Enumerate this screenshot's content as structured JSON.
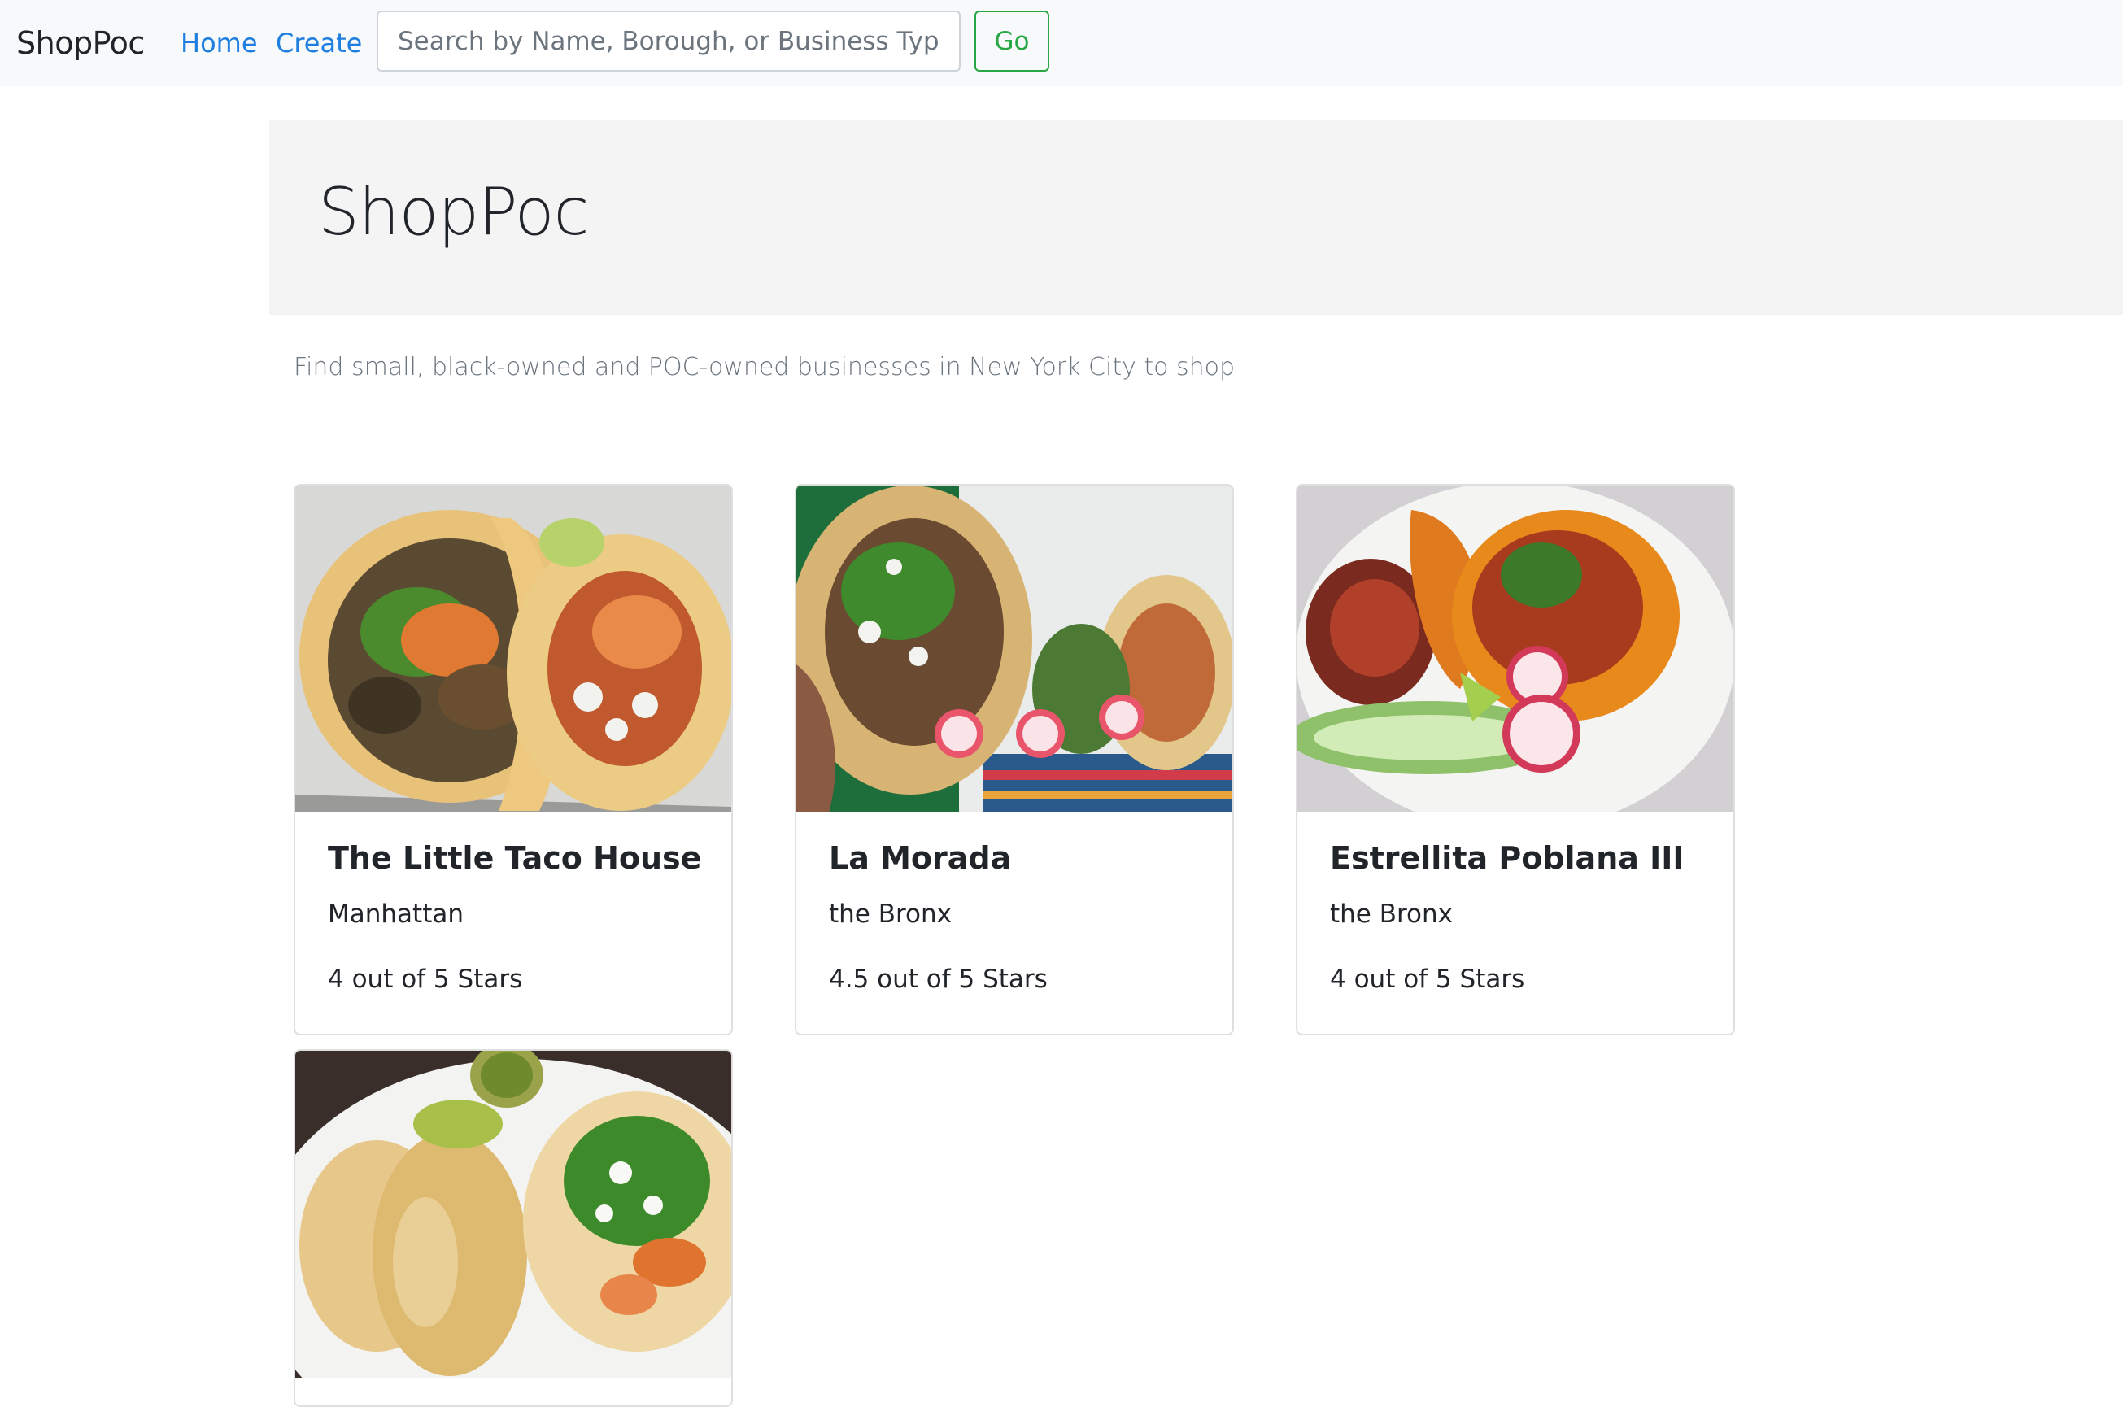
{
  "navbar": {
    "brand": "ShopPoc",
    "links": [
      "Home",
      "Create"
    ],
    "search_placeholder": "Search by Name, Borough, or Business Type",
    "go_label": "Go"
  },
  "jumbotron": {
    "title": "ShopPoc"
  },
  "lead": "Find small, black-owned and POC-owned businesses in New York City to shop",
  "businesses": [
    {
      "name": "The Little Taco House",
      "borough": "Manhattan",
      "rating": "4 out of 5 Stars"
    },
    {
      "name": "La Morada",
      "borough": "the Bronx",
      "rating": "4.5 out of 5 Stars"
    },
    {
      "name": "Estrellita Poblana III",
      "borough": "the Bronx",
      "rating": "4 out of 5 Stars"
    },
    {
      "name": "",
      "borough": "",
      "rating": ""
    }
  ],
  "colors": {
    "link": "#1f7fe0",
    "success": "#28a745",
    "navbar_bg": "#f8f9fa",
    "jumbotron_bg": "#f4f4f4"
  }
}
